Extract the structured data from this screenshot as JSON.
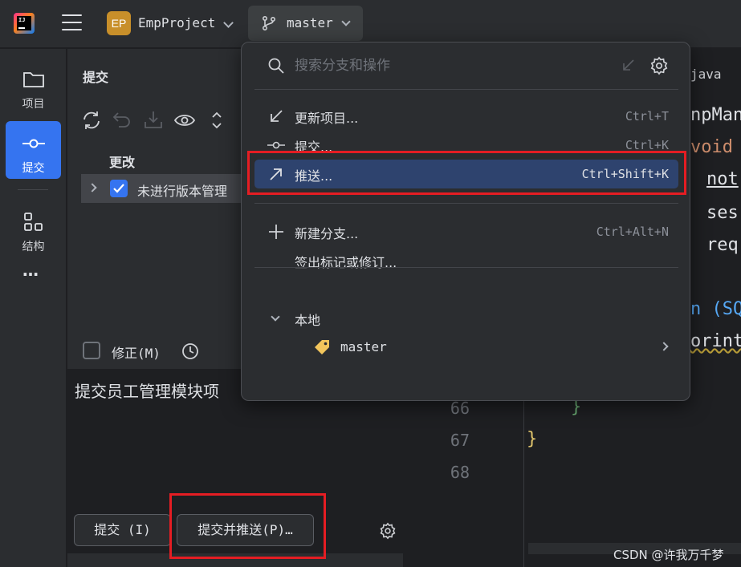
{
  "titlebar": {
    "project_badge": "EP",
    "project_name": "EmpProject",
    "branch": "master"
  },
  "toolstrip": {
    "items": [
      {
        "label": "项目",
        "icon": "folder-icon"
      },
      {
        "label": "提交",
        "icon": "commit-icon",
        "active": true
      },
      {
        "label": "结构",
        "icon": "structure-icon"
      }
    ],
    "more": "…"
  },
  "commit_panel": {
    "title": "提交",
    "changes_header": "更改",
    "changes_row": "未进行版本管理",
    "amend_label": "修正(M)",
    "message": "提交员工管理模块项",
    "commit_button": "提交 (I)",
    "commit_push_button": "提交并推送(P)…"
  },
  "editor": {
    "tab_name": "java",
    "lines": [
      "66",
      "67",
      "68"
    ],
    "code_fragments": [
      "npMan",
      "void",
      "not",
      "ses",
      "req",
      "n (SQ",
      "orint",
      "}",
      "}"
    ]
  },
  "popup": {
    "search_placeholder": "搜索分支和操作",
    "items": [
      {
        "label": "更新项目...",
        "shortcut": "Ctrl+T"
      },
      {
        "label": "提交...",
        "shortcut": "Ctrl+K"
      },
      {
        "label": "推送...",
        "shortcut": "Ctrl+Shift+K"
      },
      {
        "label": "新建分支...",
        "shortcut": "Ctrl+Alt+N"
      },
      {
        "label": "签出标记或修订...",
        "shortcut": ""
      }
    ],
    "section_label": "本地",
    "local_branch": "master"
  },
  "watermark": "CSDN @许我万千梦",
  "colors": {
    "accent": "#3574f0",
    "selection": "#2e436e",
    "highlight_box": "#e51d23",
    "keyword": "#cf8e6d",
    "paren": "#56a8f5",
    "brace": "#e0c46c"
  }
}
